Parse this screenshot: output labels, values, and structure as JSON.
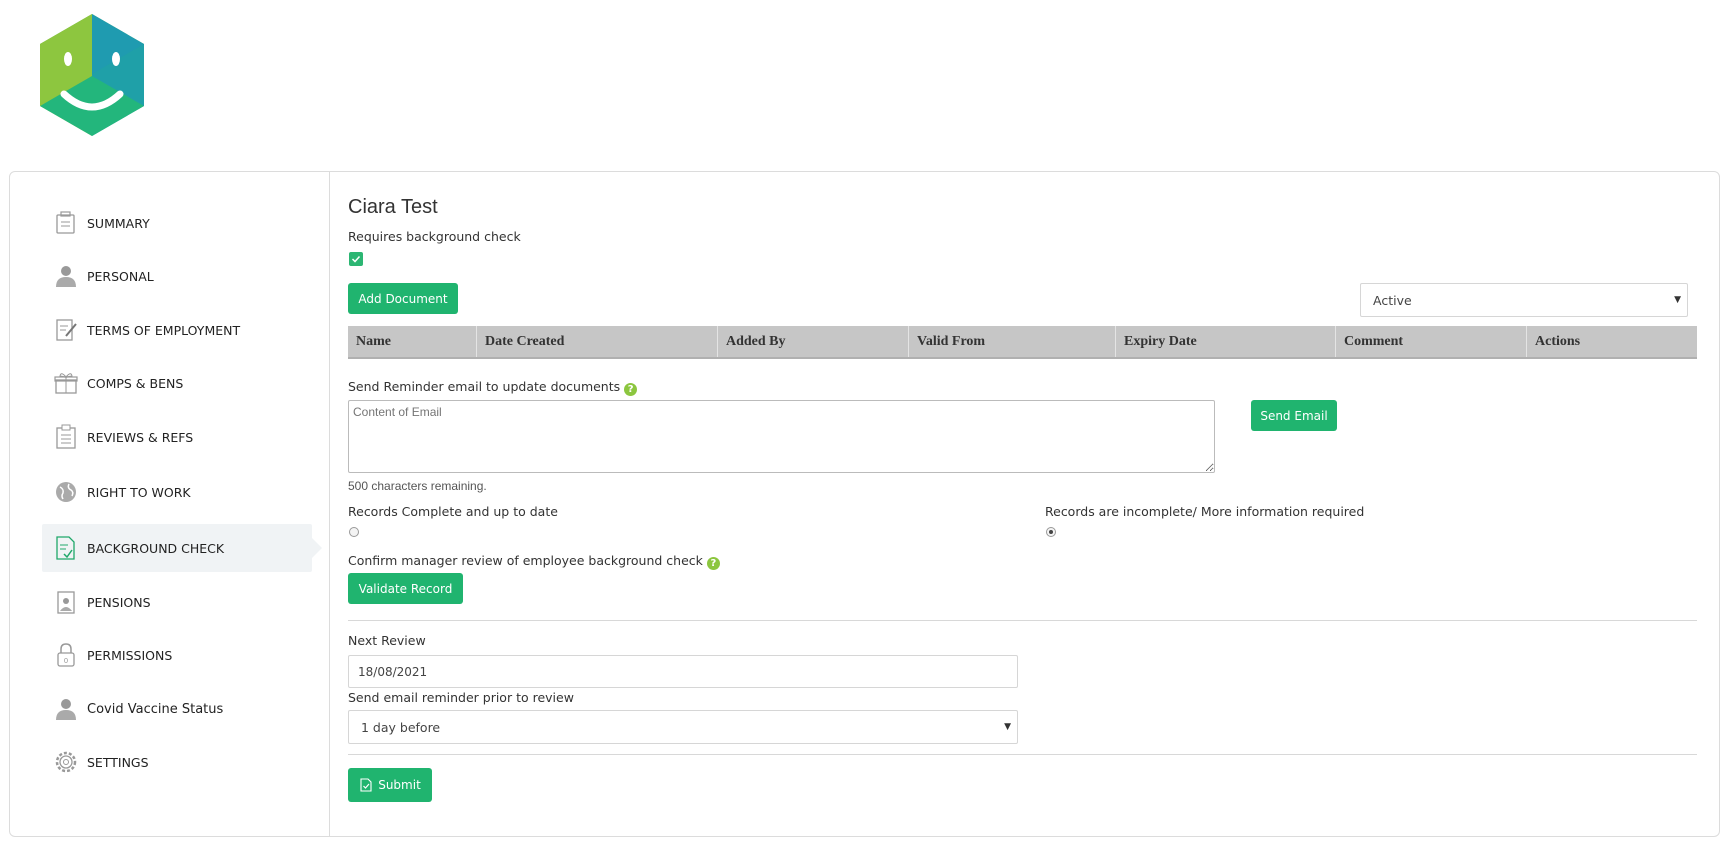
{
  "sidebar": {
    "items": [
      {
        "label": "SUMMARY",
        "icon": "summary-icon"
      },
      {
        "label": "PERSONAL",
        "icon": "person-icon"
      },
      {
        "label": "TERMS OF EMPLOYMENT",
        "icon": "document-edit-icon"
      },
      {
        "label": "COMPS & BENS",
        "icon": "gift-icon"
      },
      {
        "label": "REVIEWS & REFS",
        "icon": "clipboard-icon"
      },
      {
        "label": "RIGHT TO WORK",
        "icon": "globe-icon"
      },
      {
        "label": "BACKGROUND CHECK",
        "icon": "document-check-icon",
        "active": true
      },
      {
        "label": "PENSIONS",
        "icon": "pension-icon"
      },
      {
        "label": "PERMISSIONS",
        "icon": "lock-icon"
      },
      {
        "label": "Covid Vaccine Status",
        "icon": "person-icon"
      },
      {
        "label": "SETTINGS",
        "icon": "gear-icon"
      }
    ]
  },
  "main": {
    "title": "Ciara Test",
    "requires_check_label": "Requires background check",
    "requires_check_value": true,
    "add_document_label": "Add Document",
    "status_filter": {
      "value": "Active"
    },
    "table": {
      "columns": [
        "Name",
        "Date Created",
        "Added By",
        "Valid From",
        "Expiry Date",
        "Comment",
        "Actions"
      ],
      "rows": []
    },
    "reminder": {
      "label": "Send Reminder email to update documents",
      "placeholder": "Content of Email",
      "chars_remaining": "500 characters remaining.",
      "send_label": "Send Email"
    },
    "records": {
      "complete_label": "Records Complete and up to date",
      "incomplete_label": "Records are incomplete/ More information required",
      "selected": "incomplete"
    },
    "confirm": {
      "label": "Confirm manager review of employee background check",
      "validate_label": "Validate Record"
    },
    "next_review": {
      "label": "Next Review",
      "value": "18/08/2021"
    },
    "reminder_prior": {
      "label": "Send email reminder prior to review",
      "value": "1 day before"
    },
    "submit_label": "Submit"
  },
  "colors": {
    "accent": "#20b46f",
    "table_header": "#c6c6c6",
    "help_icon": "#8cc63f",
    "logo_green": "#8dc63f",
    "logo_teal": "#1fa0a8",
    "logo_dark_green": "#23b67c"
  }
}
